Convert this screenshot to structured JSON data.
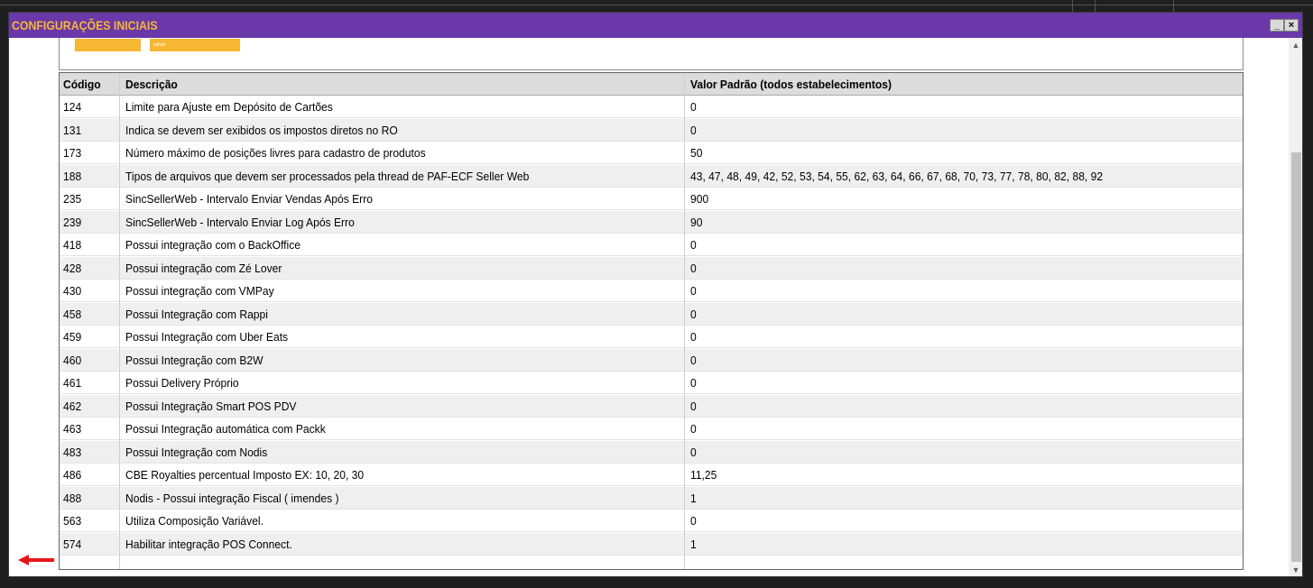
{
  "window": {
    "title": "CONFIGURAÇÕES INICIAIS",
    "minimize_label": "_",
    "close_label": "×"
  },
  "top_panel": {
    "button_small_label": "salvar"
  },
  "table": {
    "columns": [
      "Código",
      "Descrição",
      "Valor Padrão (todos estabelecimentos)"
    ],
    "rows": [
      {
        "code": "124",
        "description": "Limite para Ajuste em Depósito de Cartões",
        "value": "0"
      },
      {
        "code": "131",
        "description": "Indica se devem ser exibidos os impostos diretos no RO",
        "value": "0"
      },
      {
        "code": "173",
        "description": "Número máximo de posições livres para cadastro de produtos",
        "value": "50"
      },
      {
        "code": "188",
        "description": "Tipos de arquivos que devem ser processados pela thread de PAF-ECF Seller Web",
        "value": "43, 47, 48, 49, 42, 52, 53, 54, 55, 62, 63, 64, 66, 67, 68, 70, 73, 77, 78, 80, 82, 88, 92"
      },
      {
        "code": "235",
        "description": "SincSellerWeb - Intervalo Enviar Vendas Após Erro",
        "value": "900"
      },
      {
        "code": "239",
        "description": "SincSellerWeb - Intervalo Enviar Log Após Erro",
        "value": "90"
      },
      {
        "code": "418",
        "description": "Possui integração com o BackOffice",
        "value": "0"
      },
      {
        "code": "428",
        "description": "Possui integração com Zé Lover",
        "value": "0"
      },
      {
        "code": "430",
        "description": "Possui integração com VMPay",
        "value": "0"
      },
      {
        "code": "458",
        "description": "Possui Integração com Rappi",
        "value": "0"
      },
      {
        "code": "459",
        "description": "Possui Integração com Uber Eats",
        "value": "0"
      },
      {
        "code": "460",
        "description": "Possui Integração com B2W",
        "value": "0"
      },
      {
        "code": "461",
        "description": "Possui Delivery Próprio",
        "value": "0"
      },
      {
        "code": "462",
        "description": "Possui Integração Smart POS PDV",
        "value": "0"
      },
      {
        "code": "463",
        "description": "Possui Integração automática com Packk",
        "value": "0"
      },
      {
        "code": "483",
        "description": "Possui Integração com Nodis",
        "value": "0"
      },
      {
        "code": "486",
        "description": "CBE Royalties percentual Imposto EX: 10, 20, 30",
        "value": "11,25"
      },
      {
        "code": "488",
        "description": "Nodis - Possui integração Fiscal ( imendes )",
        "value": "1"
      },
      {
        "code": "563",
        "description": "Utiliza Composição Variável.",
        "value": "0"
      },
      {
        "code": "574",
        "description": "Habilitar integração POS Connect.",
        "value": "1"
      }
    ]
  },
  "colors": {
    "titlebar": "#6a38a8",
    "title_text": "#f6b733",
    "marker_arrow": "#e8161b"
  },
  "icons": {
    "marker": "red-arrow-icon",
    "scroll_up": "triangle-up-icon",
    "scroll_down": "triangle-down-icon"
  }
}
